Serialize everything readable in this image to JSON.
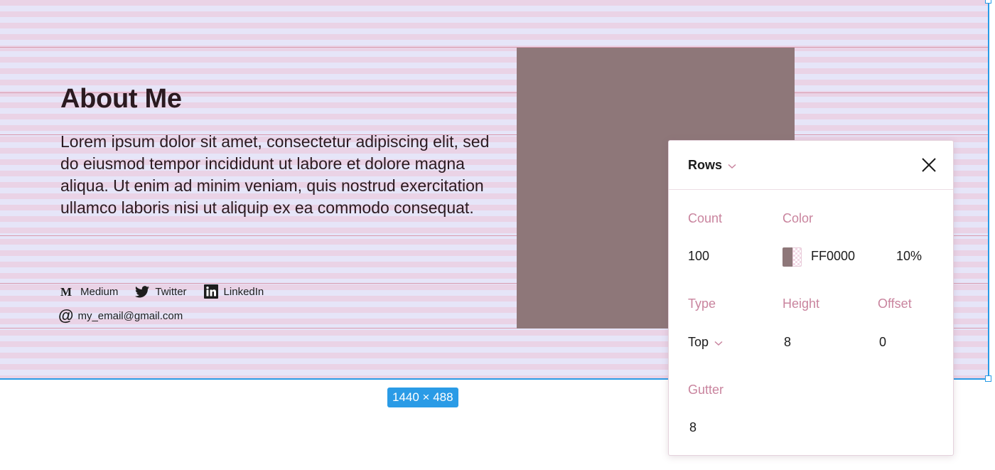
{
  "about": {
    "heading": "About Me",
    "bio": "Lorem ipsum dolor sit amet, consectetur adipiscing elit, sed do eiusmod tempor incididunt ut labore et dolore magna aliqua. Ut enim ad minim veniam, quis nostrud exercitation ullamco laboris nisi ut aliquip ex ea commodo consequat.",
    "socials": [
      {
        "label": "Medium",
        "icon": "medium-icon"
      },
      {
        "label": "Twitter",
        "icon": "twitter-icon"
      },
      {
        "label": "LinkedIn",
        "icon": "linkedin-icon"
      }
    ],
    "email": "my_email@gmail.com",
    "email_icon": "at-icon"
  },
  "frame": {
    "size_label": "1440 × 488"
  },
  "panel": {
    "title": "Rows",
    "count_label": "Count",
    "count_value": "100",
    "color_label": "Color",
    "color_hex": "FF0000",
    "color_opacity": "10%",
    "type_label": "Type",
    "type_value": "Top",
    "height_label": "Height",
    "height_value": "8",
    "offset_label": "Offset",
    "offset_value": "0",
    "gutter_label": "Gutter",
    "gutter_value": "8"
  },
  "colors": {
    "accent": "#2a9be6",
    "label": "#c9849e",
    "image_placeholder": "#8e7779"
  }
}
